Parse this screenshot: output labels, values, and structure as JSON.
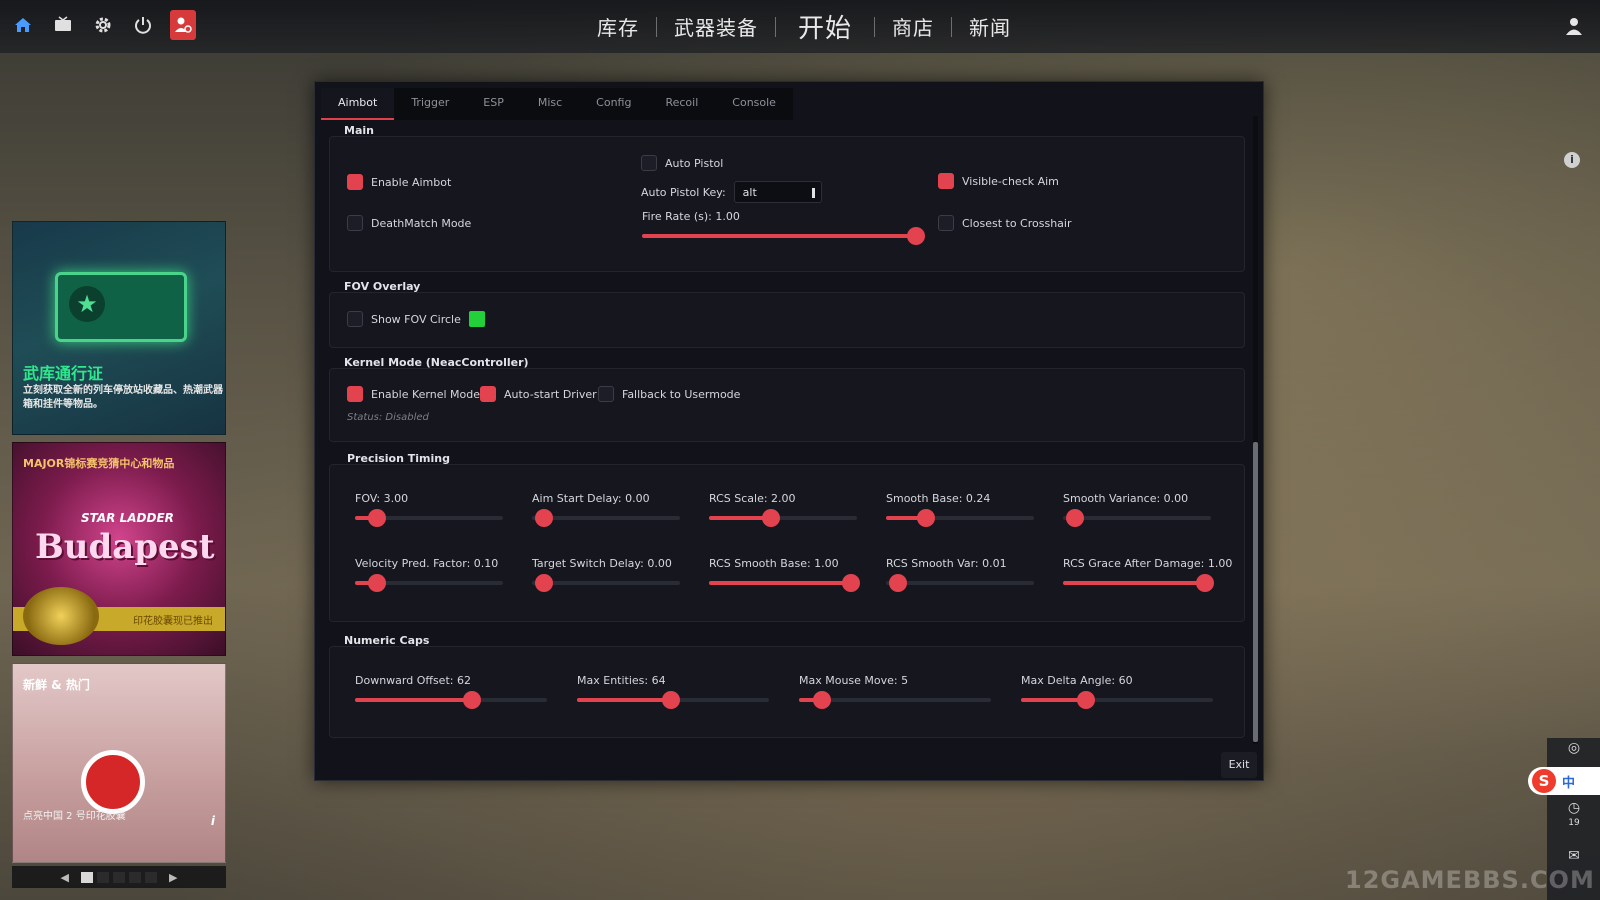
{
  "topbar": {
    "nav": [
      "库存",
      "武器装备",
      "开始",
      "商店",
      "新闻"
    ]
  },
  "promos": {
    "p1": {
      "title": "武库通行证",
      "desc": "立刻获取全新的列车停放站收藏品、热潮武器箱和挂件等物品。"
    },
    "p2": {
      "top_text": "MAJOR锦标赛竞猜中心和物品",
      "sponsor": "STAR LADDER",
      "city": "Budapest",
      "badge": "印花胶囊现已推出"
    },
    "p3": {
      "header": "新鲜 & 热门",
      "footer": "点亮中国 2 号印花胶囊",
      "info": "i"
    }
  },
  "right": {
    "info": "i",
    "ime_logo": "S",
    "ime_lang": "中",
    "rail_count": "19",
    "watermark": "12GAMEBBS.COM"
  },
  "panel": {
    "tabs": [
      "Aimbot",
      "Trigger",
      "ESP",
      "Misc",
      "Config",
      "Recoil",
      "Console"
    ],
    "active_tab": 0,
    "main": {
      "title": "Main",
      "enable_aimbot": "Enable Aimbot",
      "deathmatch": "DeathMatch Mode",
      "auto_pistol": "Auto Pistol",
      "auto_pistol_key_label": "Auto Pistol Key:",
      "auto_pistol_key_value": "alt",
      "fire_rate": {
        "label": "Fire Rate (s): 1.00",
        "value": 1.0
      },
      "visible_check": "Visible-check Aim",
      "closest": "Closest to Crosshair"
    },
    "fov_overlay": {
      "title": "FOV Overlay",
      "show_fov": "Show FOV Circle",
      "color": "#22d13a"
    },
    "kernel": {
      "title": "Kernel Mode (NeacController)",
      "enable_kernel": "Enable Kernel Mode",
      "auto_start": "Auto-start Driver",
      "fallback": "Fallback to Usermode",
      "status": "Status: Disabled"
    },
    "precision": {
      "title": "Precision  Timing",
      "sliders": [
        {
          "label": "FOV: 3.00",
          "fill": 0.15
        },
        {
          "label": "Aim Start Delay: 0.00",
          "fill": 0.0
        },
        {
          "label": "RCS Scale: 2.00",
          "fill": 0.42
        },
        {
          "label": "Smooth Base: 0.24",
          "fill": 0.27
        },
        {
          "label": "Smooth Variance: 0.00",
          "fill": 0.0
        },
        {
          "label": "Velocity Pred. Factor: 0.10",
          "fill": 0.15
        },
        {
          "label": "Target Switch Delay: 0.00",
          "fill": 0.0
        },
        {
          "label": "RCS Smooth Base: 1.00",
          "fill": 1.0
        },
        {
          "label": "RCS Smooth Var: 0.01",
          "fill": 0.0
        },
        {
          "label": "RCS Grace After Damage: 1.00",
          "fill": 1.0
        }
      ]
    },
    "numeric_caps": {
      "title": "Numeric Caps",
      "sliders": [
        {
          "label": "Downward Offset: 62",
          "fill": 0.61
        },
        {
          "label": "Max Entities: 64",
          "fill": 0.49
        },
        {
          "label": "Max Mouse Move: 5",
          "fill": 0.12
        },
        {
          "label": "Max Delta Angle: 60",
          "fill": 0.34
        }
      ]
    },
    "exit_label": "Exit"
  }
}
